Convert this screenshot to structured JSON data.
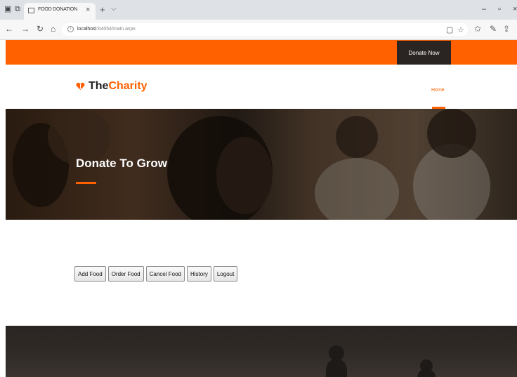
{
  "browser": {
    "tab_title": "FOOD DONATION",
    "url_host": "localhost",
    "url_rest": ":64054/main.aspx"
  },
  "site": {
    "donate_label": "Donate Now",
    "logo_the": "The",
    "logo_charity": "Charity",
    "nav_home": "Home",
    "hero_title": "Donate To Grow",
    "accent_color": "#ff6100"
  },
  "actions": [
    "Add Food",
    "Order Food",
    "Cancel Food",
    "History",
    "Logout"
  ]
}
